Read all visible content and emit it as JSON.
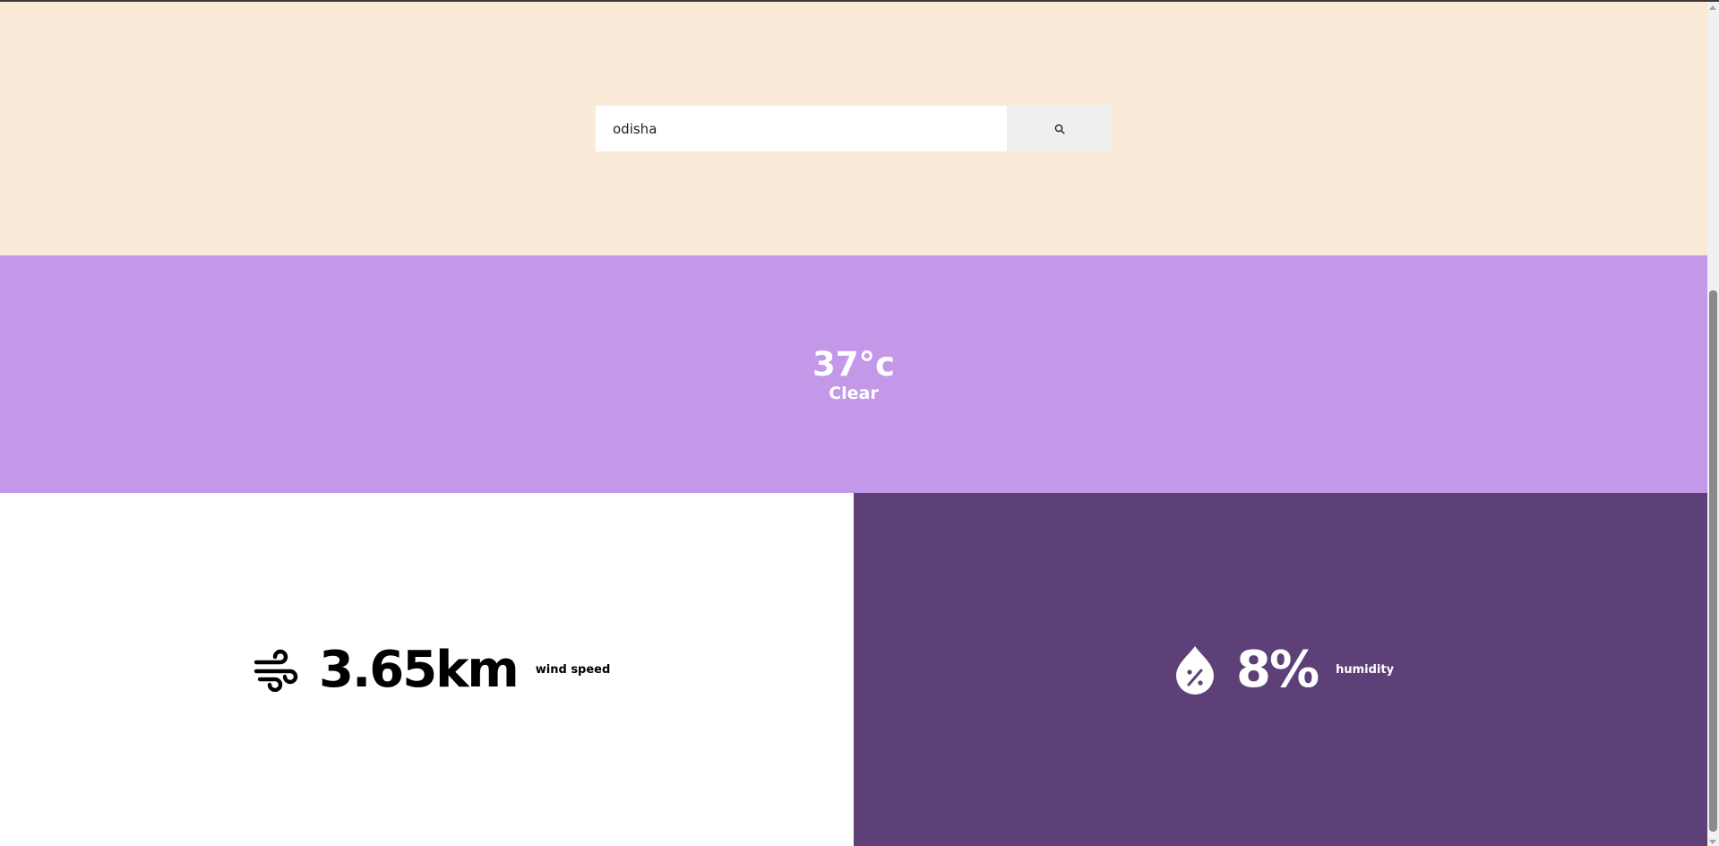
{
  "search": {
    "value": "odisha",
    "button_icon": "search-icon"
  },
  "weather": {
    "temperature": "37°c",
    "condition": "Clear"
  },
  "wind": {
    "icon": "wind-icon",
    "value": "3.65km",
    "label": "wind speed"
  },
  "humidity": {
    "icon": "humidity-drop-icon",
    "value": "8%",
    "label": "humidity"
  },
  "colors": {
    "search_bg": "#f9ebd7",
    "weather_bg": "#c398e9",
    "wind_bg": "#ffffff",
    "humidity_bg": "#5c4077",
    "wind_text": "#000000",
    "humidity_text": "#ffffff"
  }
}
